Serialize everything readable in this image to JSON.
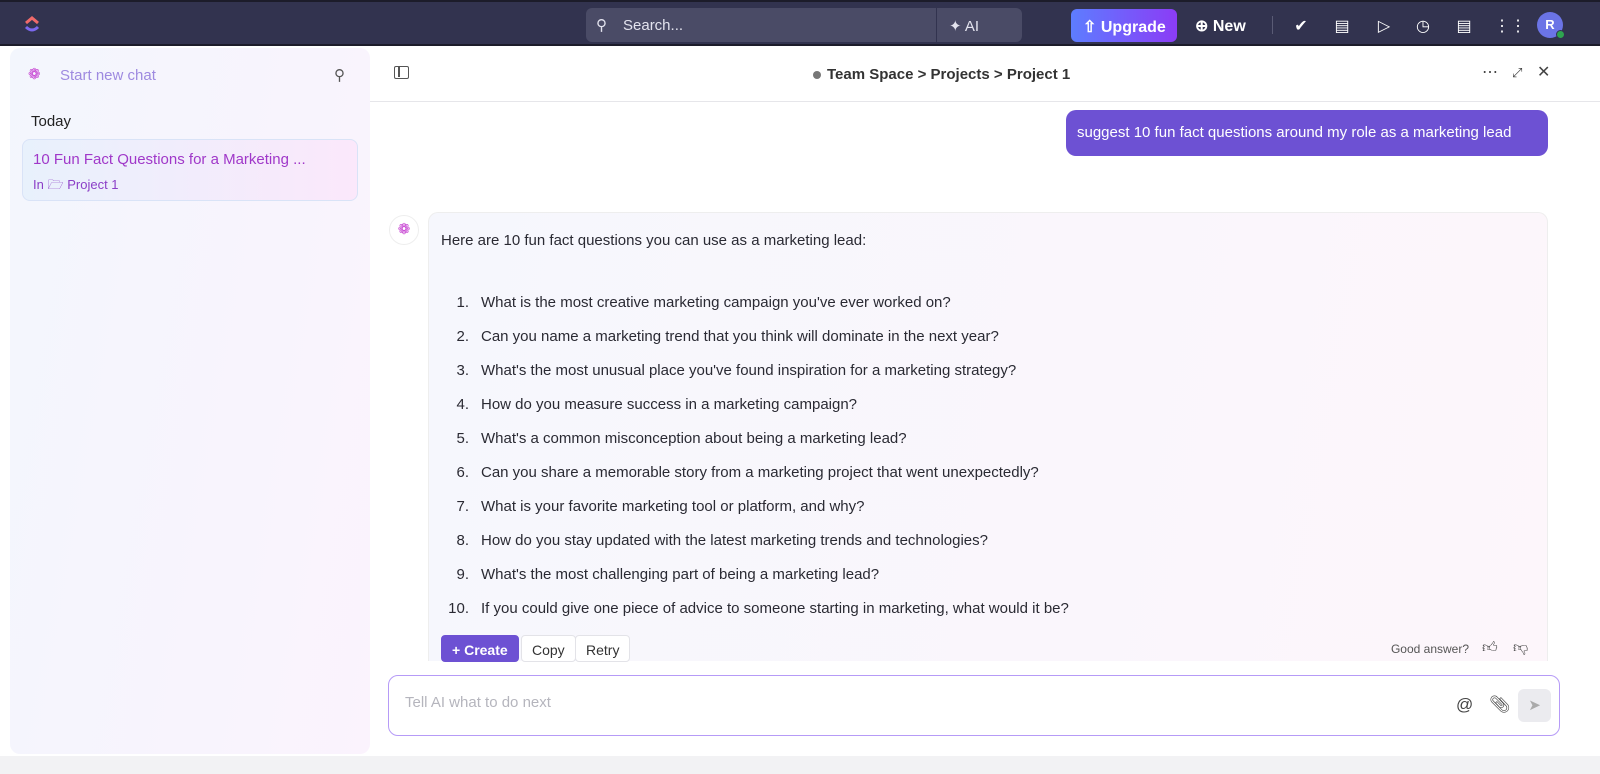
{
  "topbar": {
    "search_placeholder": "Search...",
    "ai_label": "AI",
    "upgrade_label": "Upgrade",
    "new_label": "New",
    "avatar_initial": "R"
  },
  "sidebar": {
    "start_new_chat": "Start new chat",
    "section_today": "Today",
    "chats": [
      {
        "title": "10 Fun Fact Questions for a Marketing ...",
        "location_prefix": "In",
        "location": "Project 1"
      }
    ]
  },
  "header": {
    "breadcrumb": [
      "Team Space",
      ">",
      "Projects",
      ">",
      "Project 1"
    ]
  },
  "conversation": {
    "user_message": "suggest 10 fun fact questions around my role as a marketing lead",
    "ai_intro": "Here are 10 fun fact questions you can use as a marketing lead:",
    "ai_items": [
      "What is the most creative marketing campaign you've ever worked on?",
      "Can you name a marketing trend that you think will dominate in the next year?",
      "What's the most unusual place you've found inspiration for a marketing strategy?",
      "How do you measure success in a marketing campaign?",
      "What's a common misconception about being a marketing lead?",
      "Can you share a memorable story from a marketing project that went unexpectedly?",
      "What is your favorite marketing tool or platform, and why?",
      "How do you stay updated with the latest marketing trends and technologies?",
      "What's the most challenging part of being a marketing lead?",
      "If you could give one piece of advice to someone starting in marketing, what would it be?"
    ],
    "actions": {
      "create": "Create",
      "copy": "Copy",
      "retry": "Retry",
      "feedback_prompt": "Good answer?"
    }
  },
  "composer": {
    "placeholder": "Tell AI what to do next",
    "value": ""
  }
}
